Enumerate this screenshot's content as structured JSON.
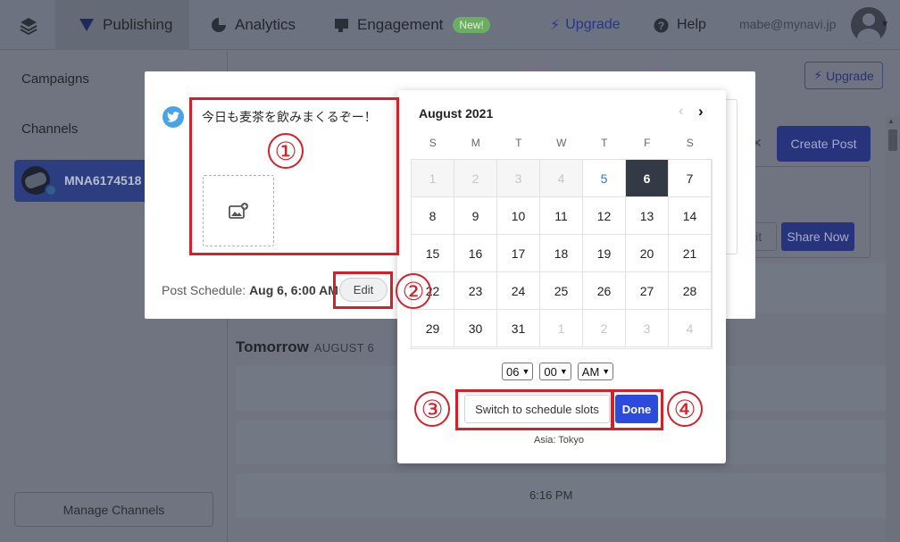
{
  "nav": {
    "publishing": "Publishing",
    "analytics": "Analytics",
    "engagement": "Engagement",
    "new_badge": "New!",
    "upgrade": "Upgrade",
    "help": "Help",
    "email": "mabe@mynavi.jp"
  },
  "sidebar": {
    "campaigns": "Campaigns",
    "channels": "Channels",
    "channel_name": "MNA6174518",
    "manage_channels": "Manage Channels"
  },
  "main": {
    "upgrade": "Upgrade",
    "create_post": "Create Post",
    "share_now": "Share Now",
    "edit_faded": "lit",
    "tomorrow": "Tomorrow",
    "tomorrow_date": "AUGUST 6",
    "time_slot": "6:16 PM"
  },
  "composer": {
    "post_text": "今日も麦茶を飲みまくるぞー！",
    "schedule_label": "Post Schedule:",
    "schedule_value": "Aug 6, 6:00 AM",
    "edit": "Edit"
  },
  "calendar": {
    "month": "August 2021",
    "prev": "‹",
    "next": "›",
    "weekdays": [
      "S",
      "M",
      "T",
      "W",
      "T",
      "F",
      "S"
    ],
    "days": [
      {
        "label": "1",
        "state": "disabled"
      },
      {
        "label": "2",
        "state": "disabled"
      },
      {
        "label": "3",
        "state": "disabled"
      },
      {
        "label": "4",
        "state": "disabled"
      },
      {
        "label": "5",
        "state": "today"
      },
      {
        "label": "6",
        "state": "selected"
      },
      {
        "label": "7",
        "state": "normal"
      },
      {
        "label": "8",
        "state": "normal"
      },
      {
        "label": "9",
        "state": "normal"
      },
      {
        "label": "10",
        "state": "normal"
      },
      {
        "label": "11",
        "state": "normal"
      },
      {
        "label": "12",
        "state": "normal"
      },
      {
        "label": "13",
        "state": "normal"
      },
      {
        "label": "14",
        "state": "normal"
      },
      {
        "label": "15",
        "state": "normal"
      },
      {
        "label": "16",
        "state": "normal"
      },
      {
        "label": "17",
        "state": "normal"
      },
      {
        "label": "18",
        "state": "normal"
      },
      {
        "label": "19",
        "state": "normal"
      },
      {
        "label": "20",
        "state": "normal"
      },
      {
        "label": "21",
        "state": "normal"
      },
      {
        "label": "22",
        "state": "normal"
      },
      {
        "label": "23",
        "state": "normal"
      },
      {
        "label": "24",
        "state": "normal"
      },
      {
        "label": "25",
        "state": "normal"
      },
      {
        "label": "26",
        "state": "normal"
      },
      {
        "label": "27",
        "state": "normal"
      },
      {
        "label": "28",
        "state": "normal"
      },
      {
        "label": "29",
        "state": "normal"
      },
      {
        "label": "30",
        "state": "normal"
      },
      {
        "label": "31",
        "state": "normal"
      },
      {
        "label": "1",
        "state": "outside"
      },
      {
        "label": "2",
        "state": "outside"
      },
      {
        "label": "3",
        "state": "outside"
      },
      {
        "label": "4",
        "state": "outside"
      }
    ],
    "hour": "06",
    "minute": "00",
    "ampm": "AM",
    "switch_label": "Switch to schedule slots",
    "done_label": "Done",
    "timezone": "Asia: Tokyo"
  },
  "annotations": {
    "n1": "①",
    "n2": "②",
    "n3": "③",
    "n4": "④"
  },
  "colors": {
    "annotation_red": "#d51f2a",
    "primary_blue": "#2c4bdc",
    "selected_day": "#343a45",
    "twitter_blue": "#4aa3e8"
  }
}
